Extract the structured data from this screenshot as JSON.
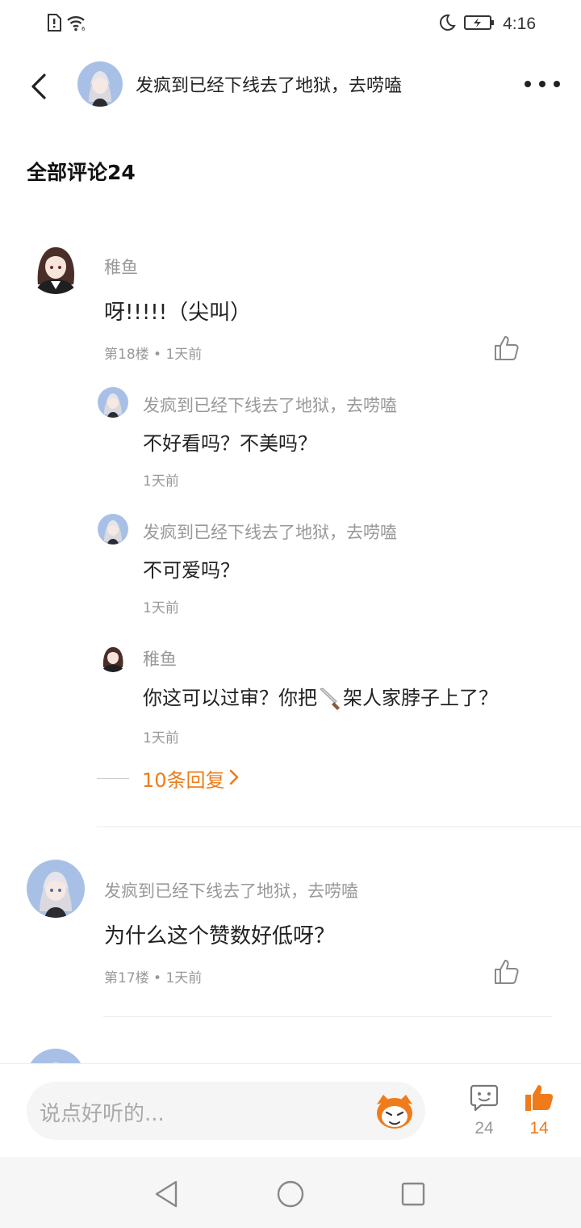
{
  "status_bar": {
    "time": "4:16",
    "icons": [
      "sim-alert-icon",
      "wifi-icon",
      "moon-icon",
      "battery-charging-icon"
    ]
  },
  "header": {
    "title": "发疯到已经下线去了地狱，去唠嗑",
    "back_icon": "chevron-left-icon",
    "more_icon": "more-horizontal-icon"
  },
  "section_title": "全部评论24",
  "comments": [
    {
      "user": "稚鱼",
      "text": "呀!!!!!（尖叫）",
      "floor": "第18楼",
      "time": "1天前",
      "replies": [
        {
          "user": "发疯到已经下线去了地狱，去唠嗑",
          "text": "不好看吗？不美吗？",
          "time": "1天前"
        },
        {
          "user": "发疯到已经下线去了地狱，去唠嗑",
          "text": "不可爱吗？",
          "time": "1天前"
        },
        {
          "user": "稚鱼",
          "text_before": "你这可以过审？你把",
          "text_after": "架人家脖子上了？",
          "time": "1天前"
        }
      ],
      "more_replies_label": "10条回复"
    },
    {
      "user": "发疯到已经下线去了地狱，去唠嗑",
      "text": "为什么这个赞数好低呀？",
      "floor": "第17楼",
      "time": "1天前"
    }
  ],
  "bottom_bar": {
    "input_placeholder": "说点好听的...",
    "comment_count": "24",
    "like_count": "14",
    "accent_color": "#f07b1a"
  },
  "colors": {
    "accent": "#f07b1a",
    "secondary_text": "#999999",
    "primary_text": "#222222"
  }
}
